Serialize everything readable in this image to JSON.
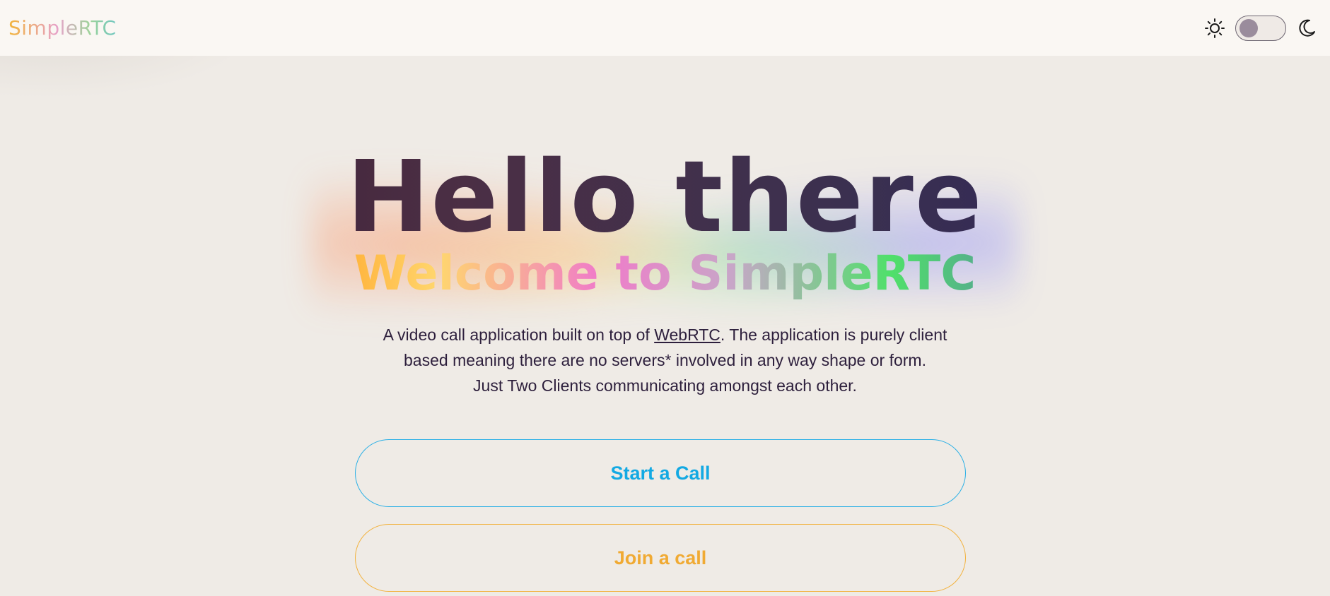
{
  "navbar": {
    "brand": "SimpleRTC",
    "theme_toggle": {
      "light_icon": "sun-icon",
      "dark_icon": "moon-icon",
      "state": "light"
    }
  },
  "hero": {
    "title": "Hello there",
    "subtitle": "Welcome to SimpleRTC",
    "description_line1_prefix": "A video call application built on top of ",
    "description_link": "WebRTC",
    "description_line1_suffix": ". The application is purely client",
    "description_line2": "based meaning there are no servers* involved in any way shape or form.",
    "description_line3": "Just Two Clients communicating amongst each other."
  },
  "actions": {
    "start_label": "Start a Call",
    "join_label": "Join a call"
  },
  "colors": {
    "background": "#efebe6",
    "navbar": "#faf7f3",
    "start_accent": "#13a9e3",
    "join_accent": "#f0aa33"
  }
}
